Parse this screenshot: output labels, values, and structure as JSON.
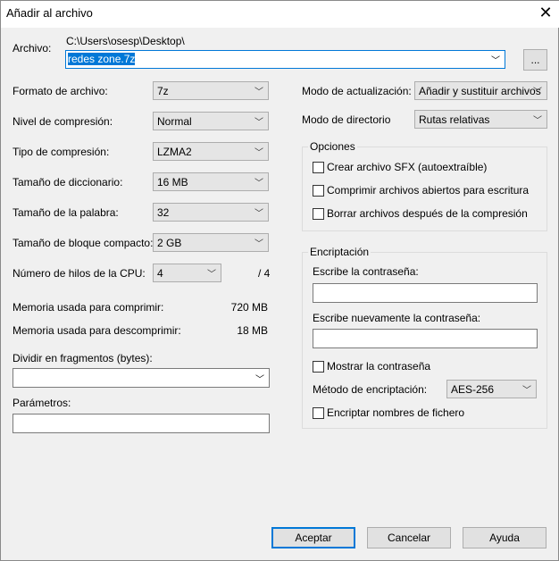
{
  "window": {
    "title": "Añadir al archivo",
    "close_icon": "close-icon"
  },
  "archive": {
    "label": "Archivo:",
    "path": "C:\\Users\\osesp\\Desktop\\",
    "filename": "redes zone.7z",
    "browse_label": "..."
  },
  "left": {
    "format": {
      "label": "Formato de archivo:",
      "value": "7z"
    },
    "level": {
      "label": "Nivel de compresión:",
      "value": "Normal"
    },
    "method": {
      "label": "Tipo de compresión:",
      "value": "LZMA2"
    },
    "dict": {
      "label": "Tamaño de diccionario:",
      "value": "16 MB"
    },
    "word": {
      "label": "Tamaño de la palabra:",
      "value": "32"
    },
    "solid": {
      "label": "Tamaño de bloque compacto:",
      "value": "2 GB"
    },
    "threads": {
      "label": "Número de hilos de la CPU:",
      "value": "4",
      "max": "/ 4"
    },
    "mem_compress": {
      "label": "Memoria usada para comprimir:",
      "value": "720 MB"
    },
    "mem_decompress": {
      "label": "Memoria usada para descomprimir:",
      "value": "18 MB"
    },
    "split": {
      "label": "Dividir en fragmentos (bytes):",
      "value": ""
    },
    "params": {
      "label": "Parámetros:",
      "value": ""
    }
  },
  "right": {
    "update": {
      "label": "Modo de actualización:",
      "value": "Añadir y sustituir archivos"
    },
    "path_mode": {
      "label": "Modo de directorio",
      "value": "Rutas relativas"
    },
    "options": {
      "title": "Opciones",
      "items": [
        {
          "label": "Crear archivo SFX (autoextraíble)",
          "checked": false
        },
        {
          "label": "Comprimir archivos abiertos para escritura",
          "checked": false
        },
        {
          "label": "Borrar archivos después de la compresión",
          "checked": false
        }
      ]
    },
    "encryption": {
      "title": "Encriptación",
      "password_label": "Escribe la contraseña:",
      "repeat_label": "Escribe nuevamente la contraseña:",
      "show_label": "Mostrar la contraseña",
      "method_label": "Método de encriptación:",
      "method_value": "AES-256",
      "encrypt_names_label": "Encriptar nombres de fichero"
    }
  },
  "buttons": {
    "ok": "Aceptar",
    "cancel": "Cancelar",
    "help": "Ayuda"
  }
}
